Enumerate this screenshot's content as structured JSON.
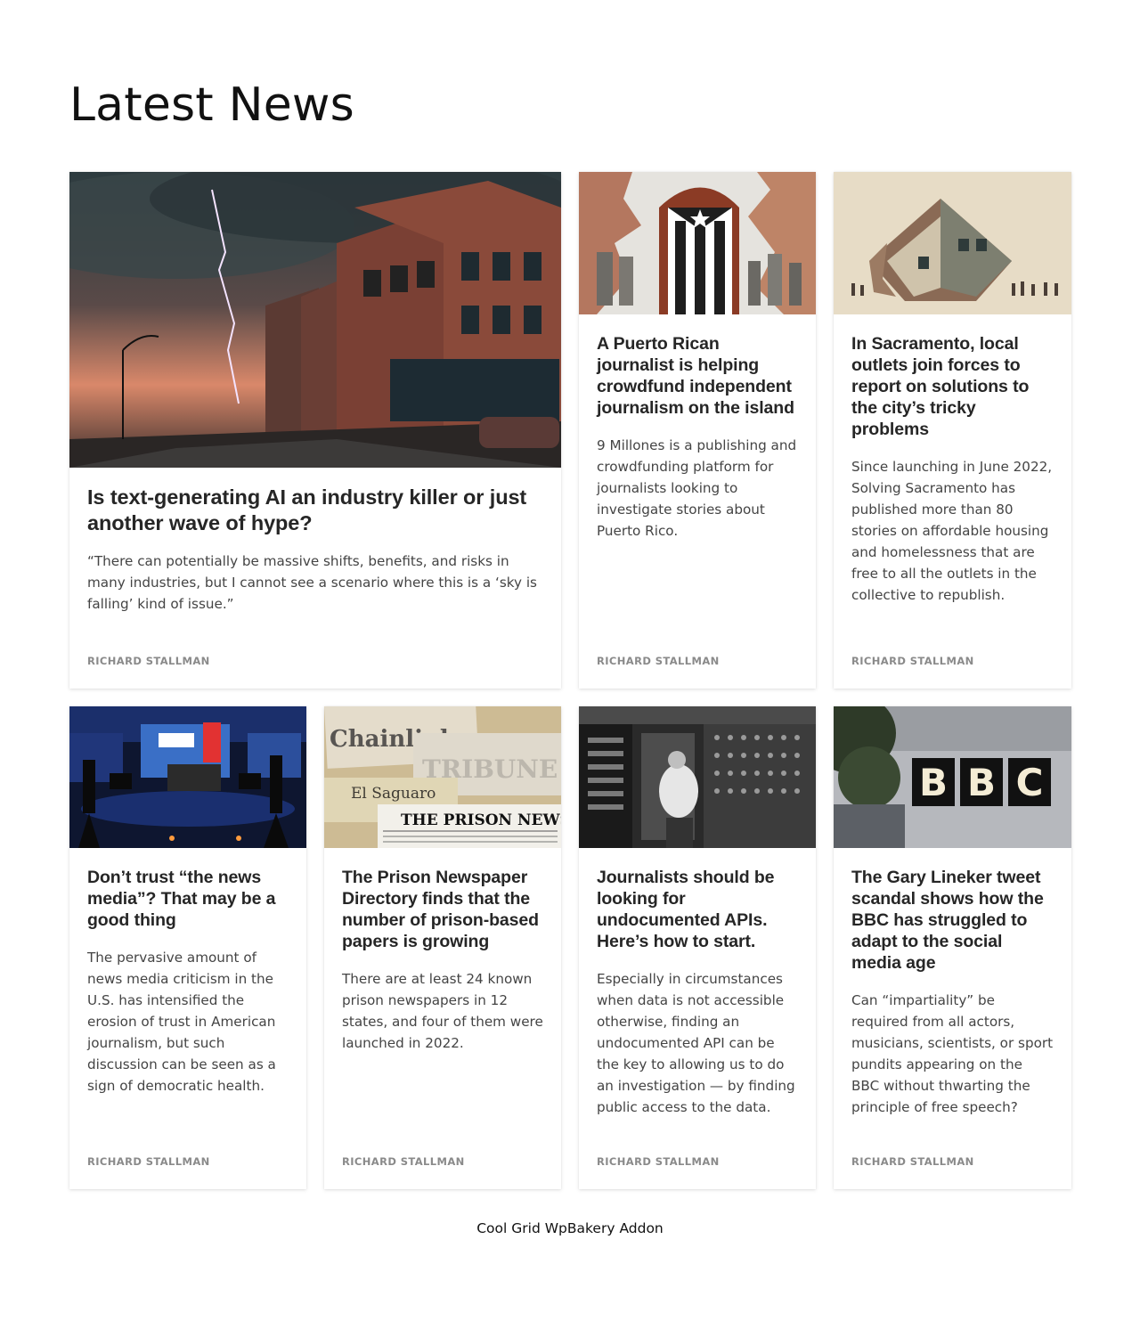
{
  "page": {
    "title": "Latest News",
    "footer": "Cool Grid WpBakery Addon"
  },
  "posts": [
    {
      "title": "Is text-generating AI an industry killer or just another wave of hype?",
      "excerpt": "“There can potentially be massive shifts, benefits, and risks in many industries, but I cannot see a scenario where this is a ‘sky is falling’ kind of issue.”",
      "author": "RICHARD STALLMAN",
      "image": "storm-town-image"
    },
    {
      "title": "A Puerto Rican journalist is helping crowdfund independent journalism on the island",
      "excerpt": "9 Millones is a publishing and crowdfunding platform for journalists looking to investigate stories about Puerto Rico.",
      "author": "RICHARD STALLMAN",
      "image": "puerto-rico-mural-image"
    },
    {
      "title": "In Sacramento, local outlets join forces to report on solutions to the city’s tricky problems",
      "excerpt": "Since launching in June 2022, Solving Sacramento has published more than 80 stories on affordable housing and homelessness that are free to all the outlets in the collective to republish.",
      "author": "RICHARD STALLMAN",
      "image": "broken-house-image"
    },
    {
      "title": "Don’t trust “the news media”? That may be a good thing",
      "excerpt": "The pervasive amount of news media criticism in the U.S. has intensified the erosion of trust in American journalism, but such discussion can be seen as a sign of democratic health.",
      "author": "RICHARD STALLMAN",
      "image": "tv-studio-image"
    },
    {
      "title": "The Prison Newspaper Directory finds that the number of prison-based papers is growing",
      "excerpt": "There are at least 24 known prison newspapers in 12 states, and four of them were launched in 2022.",
      "author": "RICHARD STALLMAN",
      "image": "prison-newspapers-image"
    },
    {
      "title": "Journalists should be looking for undocumented APIs. Here’s how to start.",
      "excerpt": "Especially in circumstances when data is not accessible otherwise, finding an undocumented API can be the key to allowing us to do an investigation — by finding public access to the data.",
      "author": "RICHARD STALLMAN",
      "image": "vintage-computer-image"
    },
    {
      "title": "The Gary Lineker tweet scandal shows how the BBC has struggled to adapt to the social media age",
      "excerpt": "Can “impartiality” be required from all actors, musicians, scientists, or sport pundits appearing on the BBC without thwarting the principle of free speech?",
      "author": "RICHARD STALLMAN",
      "image": "bbc-sign-image",
      "image_text": "BBC"
    }
  ]
}
